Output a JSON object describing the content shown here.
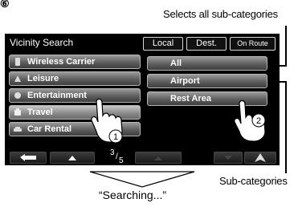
{
  "corner_mark": "⑥",
  "callouts": {
    "selects_all": "Selects all sub-categories",
    "sub_categories": "Sub-categories",
    "searching": "“Searching...”"
  },
  "screen": {
    "title": "Vicinity Search",
    "tabs": [
      {
        "label": "Local"
      },
      {
        "label": "Dest."
      },
      {
        "label": "On Route"
      }
    ],
    "categories": [
      {
        "label": "Wireless Carrier",
        "icon": "phone-icon"
      },
      {
        "label": "Leisure",
        "icon": "leisure-icon"
      },
      {
        "label": "Entertainment",
        "icon": "entertainment-icon"
      },
      {
        "label": "Travel",
        "icon": "travel-icon"
      },
      {
        "label": "Car Rental",
        "icon": "car-rental-icon"
      }
    ],
    "subcategories": [
      {
        "label": "All"
      },
      {
        "label": "Airport"
      },
      {
        "label": "Rest Area"
      }
    ],
    "page": {
      "current": "3",
      "total": "5"
    }
  },
  "steps": {
    "one": "1",
    "two": "2"
  }
}
